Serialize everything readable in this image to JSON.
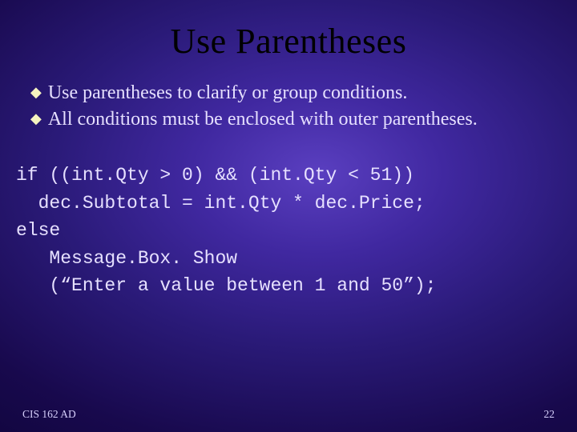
{
  "title": "Use Parentheses",
  "bullets": [
    "Use parentheses to clarify  or group conditions.",
    "All conditions must be enclosed with outer parentheses."
  ],
  "code": {
    "l1": "if ((int.Qty > 0) && (int.Qty < 51))",
    "l2": "  dec.Subtotal = int.Qty * dec.Price;",
    "l3": "else",
    "l4": "   Message.Box. Show",
    "l5": "   (“Enter a value between 1 and 50”);"
  },
  "footer": {
    "left": "CIS 162 AD",
    "right": "22"
  }
}
